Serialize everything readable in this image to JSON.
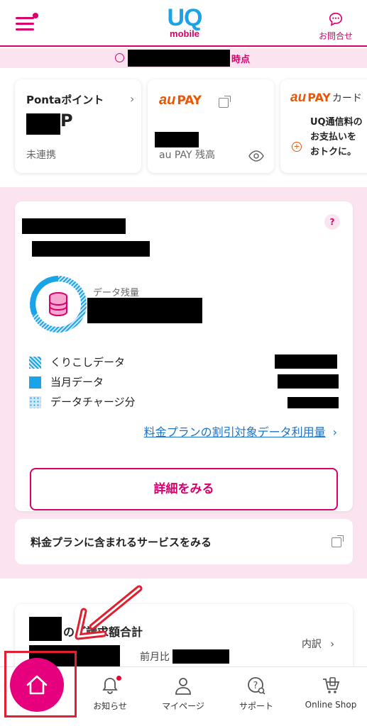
{
  "header": {
    "logo_top": "UQ",
    "logo_bottom": "mobile",
    "contact_label": "お問合せ",
    "colors": {
      "brand": "#d9006c",
      "logo_blue": "#19a3e8"
    }
  },
  "timestamp": {
    "suffix": "時点"
  },
  "cards": {
    "ponta": {
      "title": "Pontaポイント",
      "unit": "P",
      "status": "未連携"
    },
    "aupay": {
      "logo": "au",
      "logo_text": "PAY",
      "balance_label": "au PAY 残高"
    },
    "aupay_card": {
      "logo": "au",
      "logo_text": "PAY",
      "title_suffix": "カード",
      "line1": "UQ通信料の",
      "line2": "お支払いを",
      "line3": "おトクに。"
    }
  },
  "data_usage": {
    "help": "?",
    "remaining_label": "データ残量",
    "legend": [
      {
        "label": "くりこしデータ",
        "icon": "hatched-swatch"
      },
      {
        "label": "当月データ",
        "icon": "solid-swatch"
      },
      {
        "label": "データチャージ分",
        "icon": "dotted-swatch"
      }
    ],
    "plan_link": "料金プランの割引対象データ利用量",
    "detail_button": "詳細をみる"
  },
  "services_link": "料金プランに含まれるサービスをみる",
  "billing": {
    "title": "のご請求額合計",
    "breakdown": "内訳",
    "prev_month": "前月比"
  },
  "bottom_nav": [
    {
      "label": "お知らせ",
      "icon": "bell-icon"
    },
    {
      "label": "マイページ",
      "icon": "person-icon"
    },
    {
      "label": "サポート",
      "icon": "support-icon"
    },
    {
      "label": "Online Shop",
      "icon": "cart-icon"
    }
  ]
}
